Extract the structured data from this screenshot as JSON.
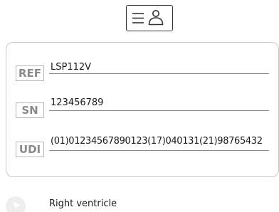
{
  "header": {
    "card_button_icon": "patient-card-icon"
  },
  "device_info": {
    "ref": {
      "label": "REF",
      "value": "LSP112V"
    },
    "sn": {
      "label": "SN",
      "value": "123456789"
    },
    "udi": {
      "label": "UDI",
      "value": "(01)01234567890123(17)040131(21)98765432"
    }
  },
  "chamber": {
    "icon": "pointer-icon",
    "label": "Right ventricle"
  }
}
